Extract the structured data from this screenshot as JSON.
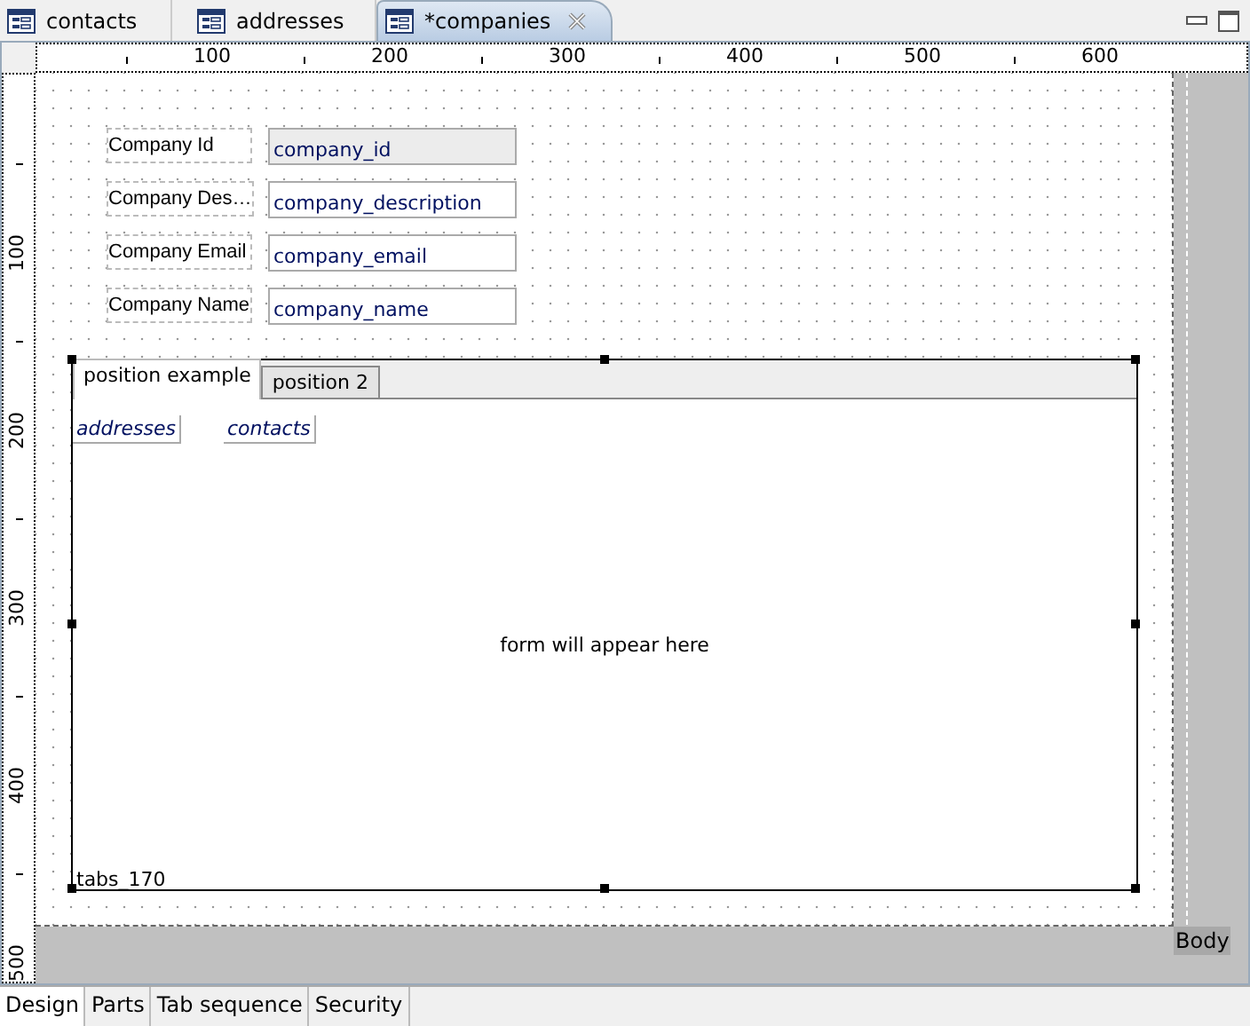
{
  "editor_tabs": [
    {
      "label": "contacts",
      "selected": false,
      "closable": false
    },
    {
      "label": "addresses",
      "selected": false,
      "closable": false
    },
    {
      "label": "*companies",
      "selected": true,
      "closable": true
    }
  ],
  "ruler": {
    "horizontal": [
      "100",
      "200",
      "300",
      "400",
      "500",
      "600"
    ],
    "vertical": [
      "100",
      "200",
      "300",
      "400",
      "500"
    ]
  },
  "form": {
    "fields": [
      {
        "label": "Company Id",
        "value": "company_id",
        "disabled": true
      },
      {
        "label": "Company Des…",
        "value": "company_description",
        "disabled": false
      },
      {
        "label": "Company Email",
        "value": "company_email",
        "disabled": false
      },
      {
        "label": "Company Name",
        "value": "company_name",
        "disabled": false
      }
    ],
    "tab_panel": {
      "name": "tabs_170",
      "tabs": [
        {
          "label": "position example",
          "selected": true
        },
        {
          "label": "position 2",
          "selected": false
        }
      ],
      "buttons": [
        "addresses",
        "contacts"
      ],
      "placeholder": "form will appear here"
    }
  },
  "part": "Body",
  "bottom_tabs": [
    {
      "label": "Design",
      "selected": true
    },
    {
      "label": "Parts",
      "selected": false
    },
    {
      "label": "Tab sequence",
      "selected": false
    },
    {
      "label": "Security",
      "selected": false
    }
  ]
}
